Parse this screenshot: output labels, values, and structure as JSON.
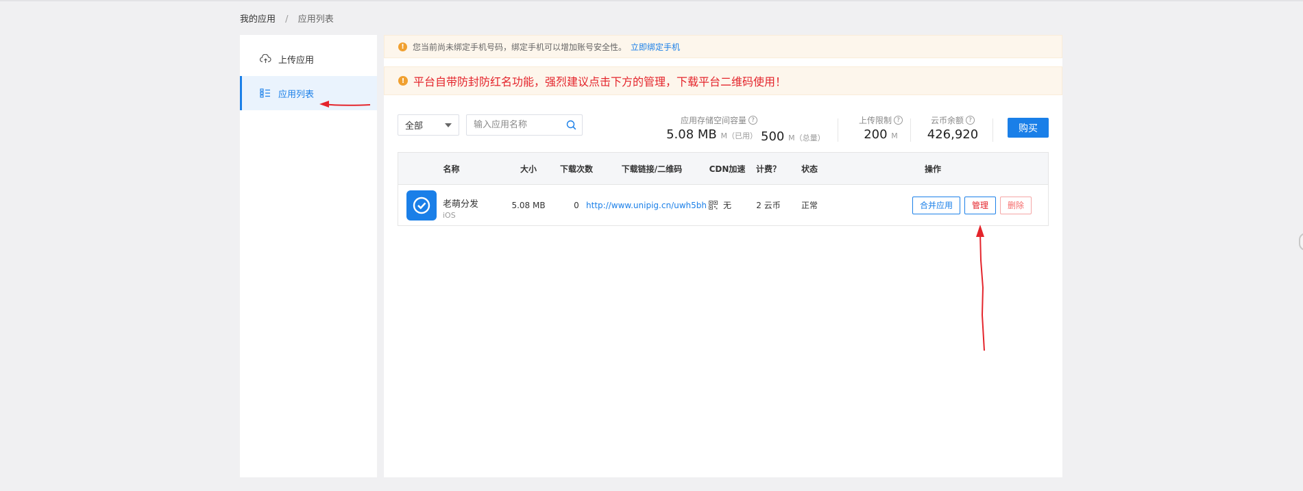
{
  "breadcrumb": {
    "parent": "我的应用",
    "separator": "/",
    "current": "应用列表"
  },
  "sidebar": {
    "items": [
      {
        "label": "上传应用",
        "icon": "cloud-upload-icon",
        "active": false
      },
      {
        "label": "应用列表",
        "icon": "list-icon",
        "active": true
      }
    ]
  },
  "notices": {
    "phone": {
      "text": "您当前尚未绑定手机号码，绑定手机可以增加账号安全性。",
      "link": "立即绑定手机"
    },
    "warning": {
      "text": "平台自带防封防红名功能，强烈建议点击下方的管理，下载平台二维码使用！"
    }
  },
  "filters": {
    "select_value": "全部",
    "search_placeholder": "输入应用名称"
  },
  "stats": {
    "storage": {
      "label": "应用存储空间容量",
      "used": "5.08 MB",
      "used_unit": "M（已用）",
      "total": "500",
      "total_unit": "M（总量）"
    },
    "upload_limit": {
      "label": "上传限制",
      "value": "200",
      "unit": "M"
    },
    "coin_balance": {
      "label": "云币余额",
      "value": "426,920"
    },
    "buy_label": "购买"
  },
  "table": {
    "headers": [
      "名称",
      "大小",
      "下载次数",
      "下载链接/二维码",
      "CDN加速",
      "计费？",
      "状态",
      "操作"
    ],
    "rows": [
      {
        "name": "老萌分发",
        "platform": "iOS",
        "size": "5.08 MB",
        "downloads": "0",
        "link": "http://www.unipig.cn/uwh5bh",
        "cdn": "无",
        "billing": "2 云币",
        "status": "正常",
        "actions": {
          "merge": "合并应用",
          "manage": "管理",
          "delete": "删除"
        }
      }
    ]
  },
  "colors": {
    "accent": "#1a7fe8",
    "annotation": "#e4242b",
    "warning_bg": "#fdf6ec"
  }
}
